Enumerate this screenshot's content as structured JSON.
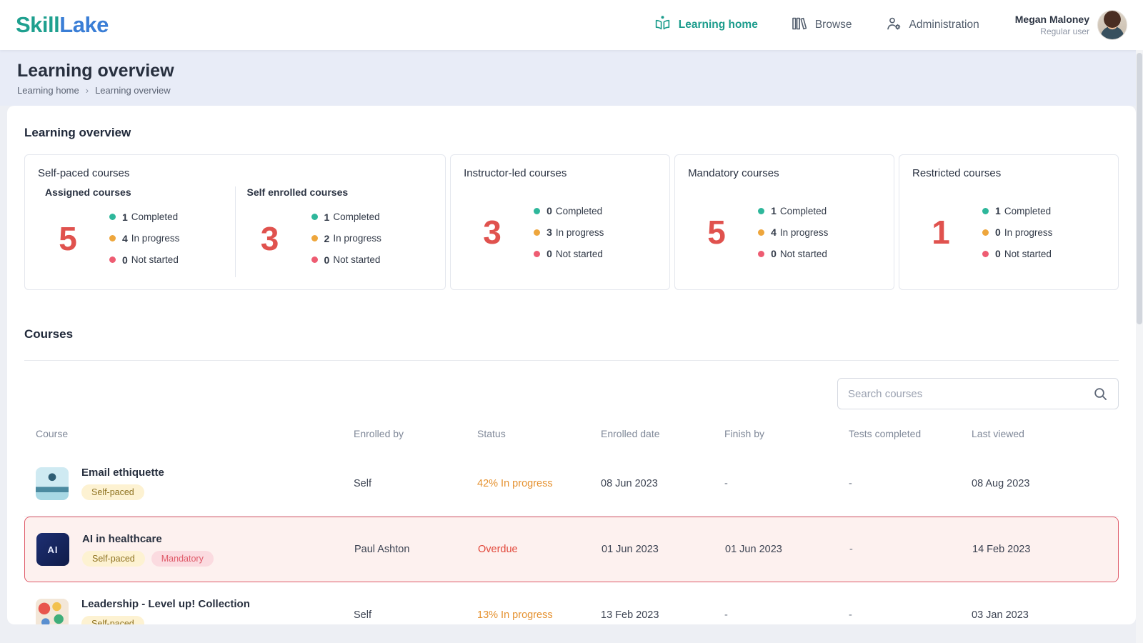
{
  "brand": {
    "skill": "Skill",
    "lake": "Lake"
  },
  "nav": {
    "items": [
      {
        "label": "Learning home",
        "active": true
      },
      {
        "label": "Browse",
        "active": false
      },
      {
        "label": "Administration",
        "active": false
      }
    ],
    "user": {
      "name": "Megan Maloney",
      "role": "Regular user"
    }
  },
  "header": {
    "title": "Learning overview",
    "breadcrumb": [
      "Learning home",
      "Learning overview"
    ],
    "separator": "›"
  },
  "overview": {
    "title": "Learning overview",
    "legend_labels": {
      "completed": "Completed",
      "in_progress": "In progress",
      "not_started": "Not started"
    },
    "self_paced": {
      "title": "Self-paced courses",
      "sections": [
        {
          "title": "Assigned courses",
          "total": "5",
          "completed": "1",
          "in_progress": "4",
          "not_started": "0"
        },
        {
          "title": "Self enrolled courses",
          "total": "3",
          "completed": "1",
          "in_progress": "2",
          "not_started": "0"
        }
      ]
    },
    "cards": [
      {
        "title": "Instructor-led courses",
        "total": "3",
        "completed": "0",
        "in_progress": "3",
        "not_started": "0"
      },
      {
        "title": "Mandatory courses",
        "total": "5",
        "completed": "1",
        "in_progress": "4",
        "not_started": "0"
      },
      {
        "title": "Restricted courses",
        "total": "1",
        "completed": "1",
        "in_progress": "0",
        "not_started": "0"
      }
    ]
  },
  "courses": {
    "title": "Courses",
    "search_placeholder": "Search courses",
    "columns": [
      "Course",
      "Enrolled by",
      "Status",
      "Enrolled date",
      "Finish by",
      "Tests completed",
      "Last viewed"
    ],
    "rows": [
      {
        "name": "Email ethiquette",
        "thumb_text": "",
        "badges": [
          "Self-paced"
        ],
        "enrolled_by": "Self",
        "status": "42% In progress",
        "enrolled_date": "08 Jun 2023",
        "finish_by": "-",
        "tests_completed": "-",
        "last_viewed": "08 Aug 2023"
      },
      {
        "name": "AI in healthcare",
        "thumb_text": "AI",
        "badges": [
          "Self-paced",
          "Mandatory"
        ],
        "enrolled_by": "Paul Ashton",
        "status": "Overdue",
        "enrolled_date": "01 Jun 2023",
        "finish_by": "01 Jun 2023",
        "tests_completed": "-",
        "last_viewed": "14 Feb 2023"
      },
      {
        "name": "Leadership - Level up! Collection",
        "thumb_text": "",
        "badges": [
          "Self-paced"
        ],
        "enrolled_by": "Self",
        "status": "13% In progress",
        "enrolled_date": "13 Feb 2023",
        "finish_by": "-",
        "tests_completed": "-",
        "last_viewed": "03 Jan 2023"
      }
    ]
  },
  "colors": {
    "accent_teal": "#1b9c8c",
    "accent_blue": "#3a7ed6",
    "completed": "#2eb79b",
    "in_progress": "#eea63c",
    "not_started": "#ee5c72",
    "status_progress": "#e5912f",
    "status_overdue": "#e2473a",
    "highlight_border": "#df5a69",
    "big_number": "#e0524e"
  }
}
